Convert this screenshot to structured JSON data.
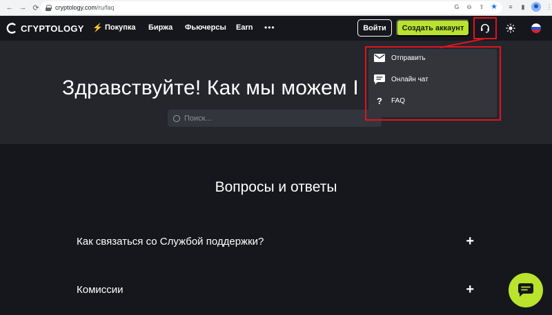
{
  "browser": {
    "url_domain": "cryptology.com",
    "url_path": "/ru/faq"
  },
  "header": {
    "logo_text": "CГYPTOLOGY",
    "nav": [
      {
        "label": "Покупка"
      },
      {
        "label": "Биржа"
      },
      {
        "label": "Фьючерсы"
      },
      {
        "label": "Earn"
      }
    ],
    "more_label": "•••",
    "login_label": "Войти",
    "create_account_label": "Создать аккаунт"
  },
  "hero": {
    "title": "Здравствуйте! Как мы можем I",
    "search_placeholder": "Поиск..."
  },
  "faq": {
    "title": "Вопросы и ответы",
    "items": [
      {
        "question": "Как связаться со Службой поддержки?"
      },
      {
        "question": "Комиссии"
      }
    ]
  },
  "support_menu": {
    "items": [
      {
        "label": "Отправить",
        "icon": "mail-icon"
      },
      {
        "label": "Онлайн чат",
        "icon": "chat-icon"
      },
      {
        "label": "FAQ",
        "icon": "question-icon"
      }
    ]
  },
  "colors": {
    "accent": "#b9e32c",
    "highlight": "#e1141c",
    "background": "#16171c",
    "hero": "#24262c"
  }
}
